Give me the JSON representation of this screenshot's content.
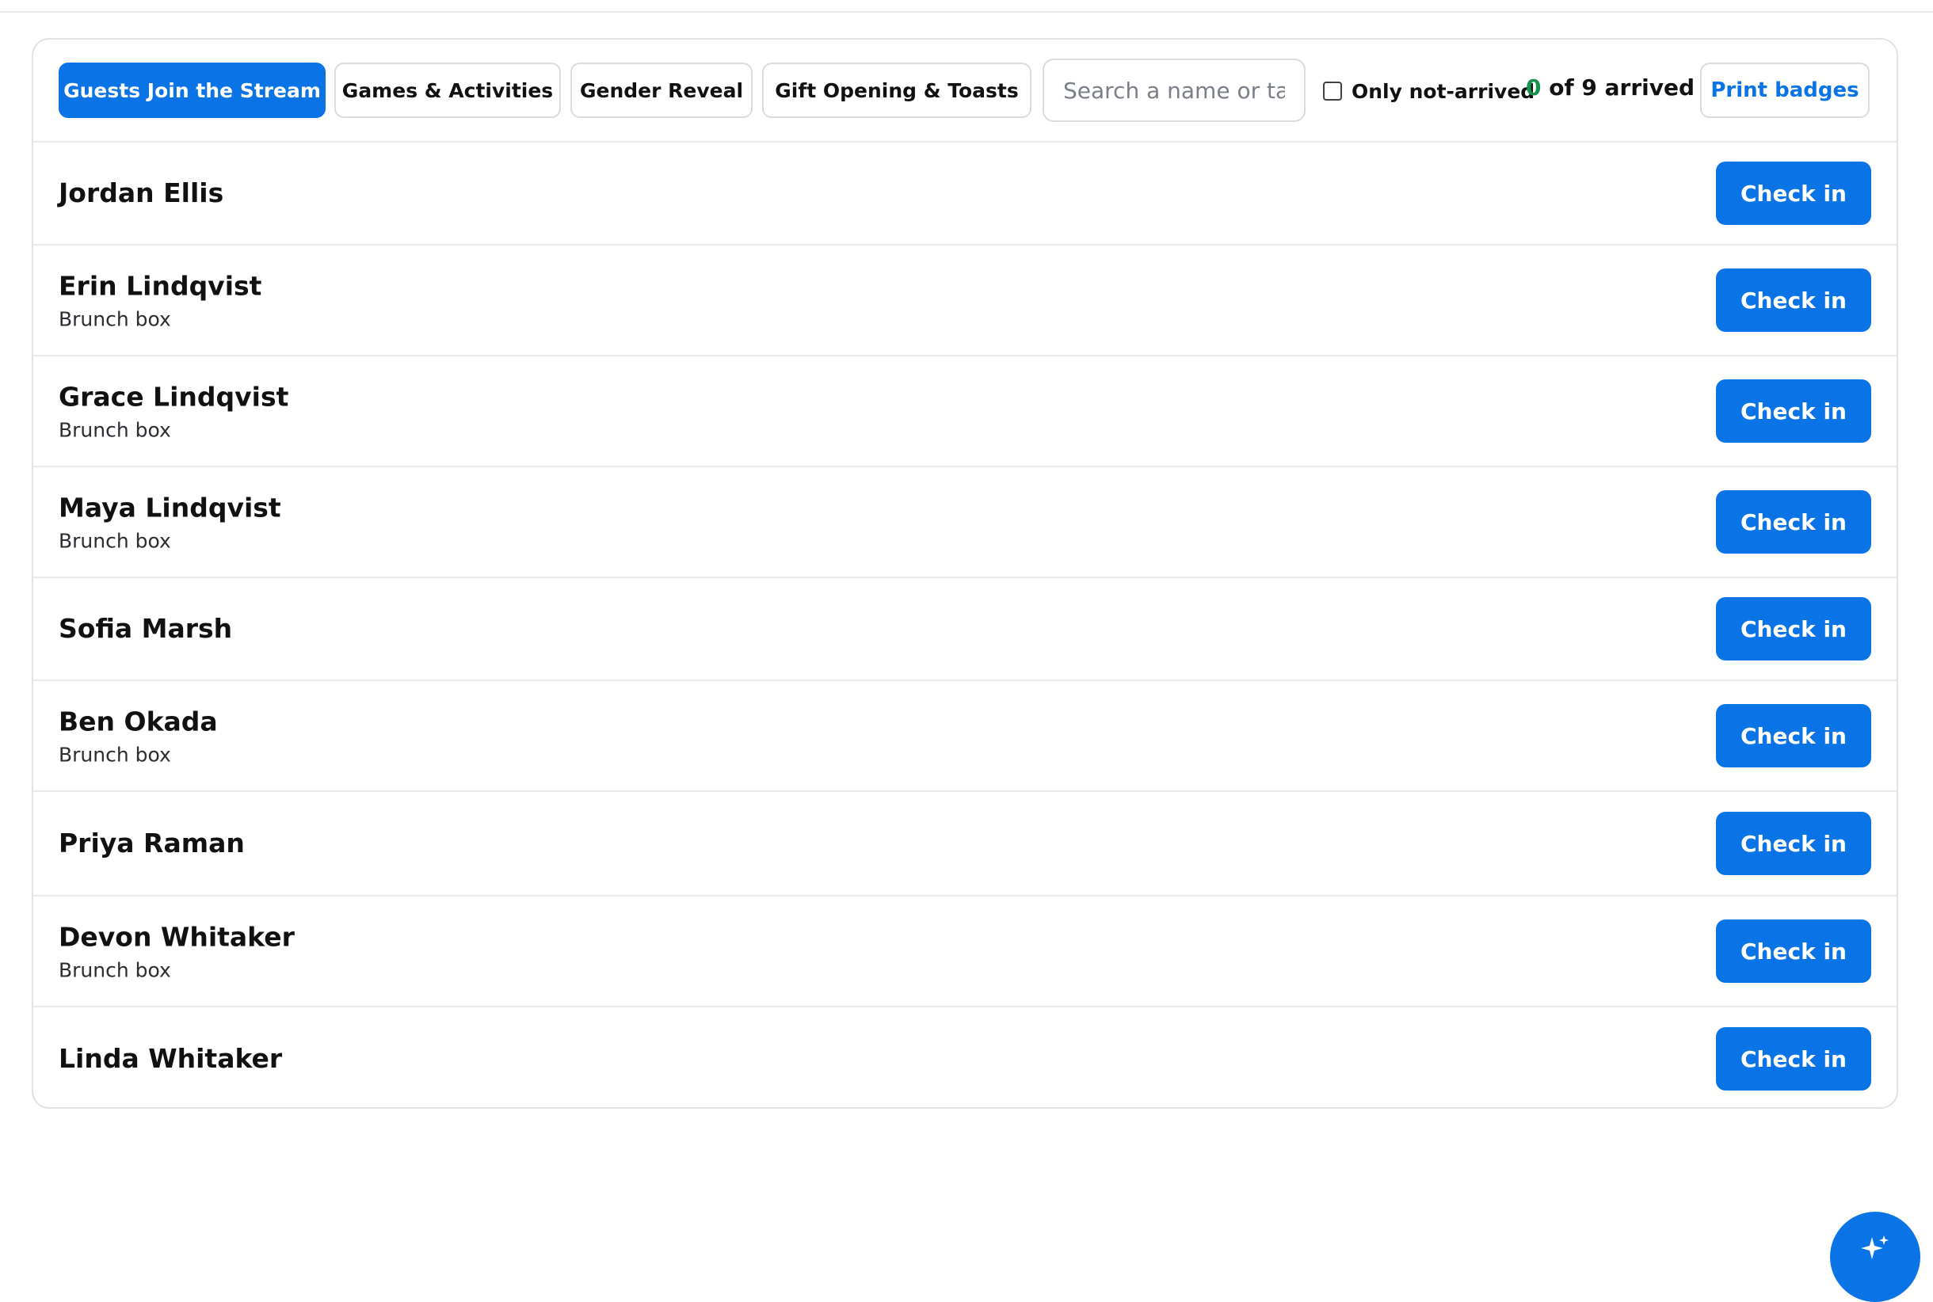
{
  "tabs": [
    {
      "label": "Guests Join the Stream",
      "active": true
    },
    {
      "label": "Games & Activities",
      "active": false
    },
    {
      "label": "Gender Reveal",
      "active": false
    },
    {
      "label": "Gift Opening & Toasts",
      "active": false
    }
  ],
  "search": {
    "placeholder": "Search a name or table",
    "value": ""
  },
  "filter": {
    "label": "Only not-arrived",
    "checked": false
  },
  "arrived": {
    "count": "0",
    "text": "of 9 arrived"
  },
  "print_label": "Print badges",
  "guests": [
    {
      "name": "Jordan Ellis",
      "meta": "",
      "action": "Check in"
    },
    {
      "name": "Erin Lindqvist",
      "meta": "Brunch box",
      "action": "Check in"
    },
    {
      "name": "Grace Lindqvist",
      "meta": "Brunch box",
      "action": "Check in"
    },
    {
      "name": "Maya Lindqvist",
      "meta": "Brunch box",
      "action": "Check in"
    },
    {
      "name": "Sofia Marsh",
      "meta": "",
      "action": "Check in"
    },
    {
      "name": "Ben Okada",
      "meta": "Brunch box",
      "action": "Check in"
    },
    {
      "name": "Priya Raman",
      "meta": "",
      "action": "Check in"
    },
    {
      "name": "Devon Whitaker",
      "meta": "Brunch box",
      "action": "Check in"
    },
    {
      "name": "Linda Whitaker",
      "meta": "",
      "action": "Check in"
    }
  ],
  "colors": {
    "accent": "#0a73e6",
    "arrived_count": "#15924b",
    "border": "#dfe2e6"
  },
  "icons": {
    "fab": "sparkle-icon"
  }
}
